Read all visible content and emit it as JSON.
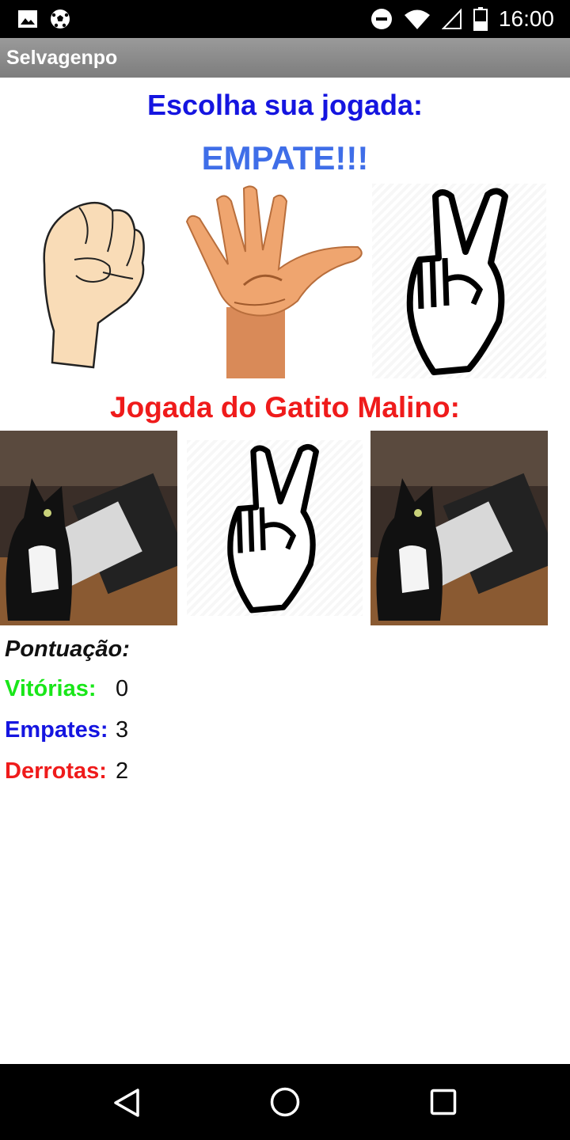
{
  "status_bar": {
    "time": "16:00",
    "icons": [
      "image-icon",
      "soccer-ball-icon",
      "do-not-disturb-icon",
      "wifi-icon",
      "signal-icon",
      "battery-icon"
    ]
  },
  "app": {
    "title": "Selvagenpo"
  },
  "player": {
    "prompt": "Escolha sua jogada:",
    "result": "EMPATE!!!",
    "choices": [
      "rock-hand-image",
      "paper-hand-image",
      "scissors-hand-image"
    ]
  },
  "opponent": {
    "heading": "Jogada do Gatito Malino:",
    "images": [
      "cat-at-computer-image",
      "scissors-hand-image",
      "cat-at-computer-image"
    ]
  },
  "score": {
    "title": "Pontuação:",
    "wins_label": "Vitórias:",
    "wins_value": "0",
    "draws_label": "Empates:",
    "draws_value": "3",
    "losses_label": "Derrotas:",
    "losses_value": "2"
  },
  "colors": {
    "prompt": "#1515e0",
    "result": "#3f6ee8",
    "opponent": "#ef1b1b",
    "wins": "#19e619",
    "draws": "#1515e0",
    "losses": "#ef1b1b"
  },
  "nav": [
    "back-icon",
    "home-icon",
    "recents-icon"
  ]
}
